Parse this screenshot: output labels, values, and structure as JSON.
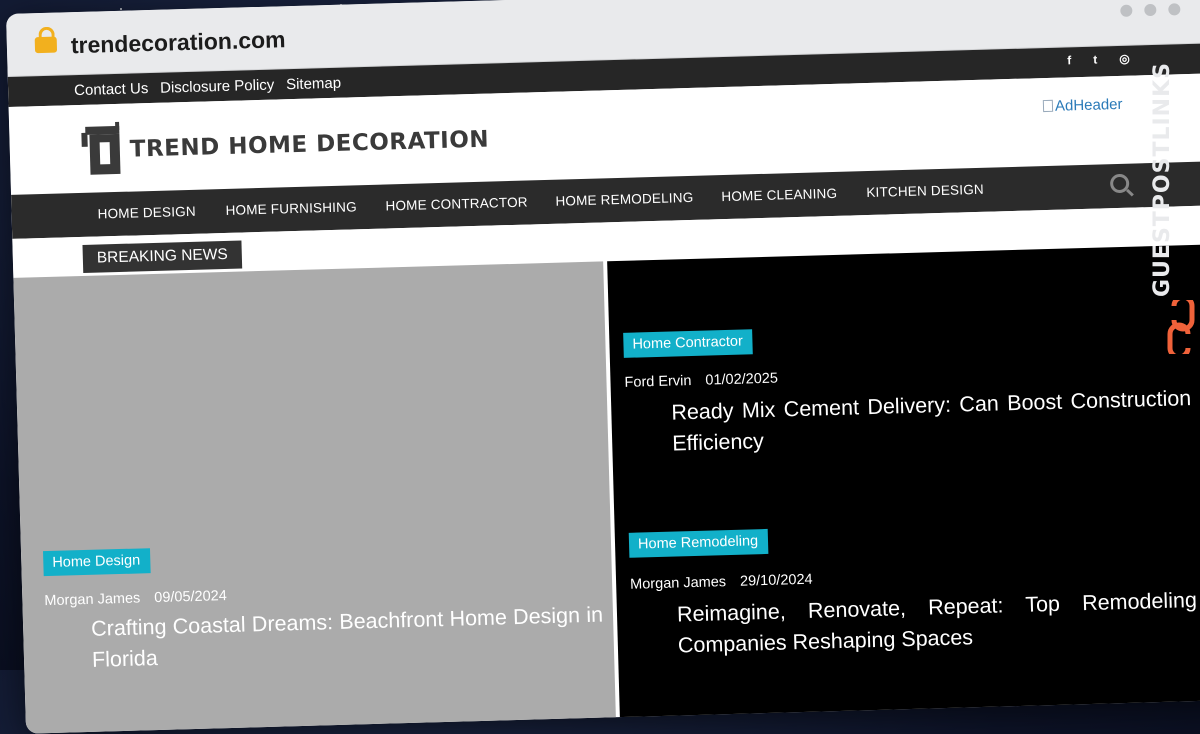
{
  "browser": {
    "url": "trendecoration.com"
  },
  "topbar": {
    "links": [
      "Contact Us",
      "Disclosure Policy",
      "Sitemap"
    ],
    "social_icons": [
      "facebook-icon",
      "twitter-icon",
      "instagram-icon"
    ],
    "social_glyphs": [
      "f",
      "t",
      "◎"
    ]
  },
  "header": {
    "logo_text": "TREND HOME DECORATION",
    "ad_alt": "AdHeader"
  },
  "nav": {
    "items": [
      "HOME DESIGN",
      "HOME FURNISHING",
      "HOME CONTRACTOR",
      "HOME REMODELING",
      "HOME CLEANING",
      "KITCHEN DESIGN"
    ]
  },
  "breaking": {
    "label": "BREAKING NEWS"
  },
  "posts": [
    {
      "category": "Home Design",
      "author": "Morgan James",
      "date": "09/05/2024",
      "title": "Crafting Coastal Dreams: Beachfront Home Design in Florida"
    },
    {
      "category": "Home Contractor",
      "author": "Ford Ervin",
      "date": "01/02/2025",
      "title": "Ready Mix Cement Delivery: Can Boost Construction Efficiency"
    },
    {
      "category": "Home Remodeling",
      "author": "Morgan James",
      "date": "29/10/2024",
      "title": "Reimagine, Renovate, Repeat: Top Remodeling Companies Reshaping Spaces"
    }
  ],
  "watermark": {
    "text": "GUESTPOSTLINKS"
  },
  "colors": {
    "category_badge": "#12b0c9",
    "nav_bg": "#2b2b2b",
    "topbar_bg": "#262626",
    "ad_link": "#2a7ab8",
    "watermark_accent": "#f0623a"
  }
}
